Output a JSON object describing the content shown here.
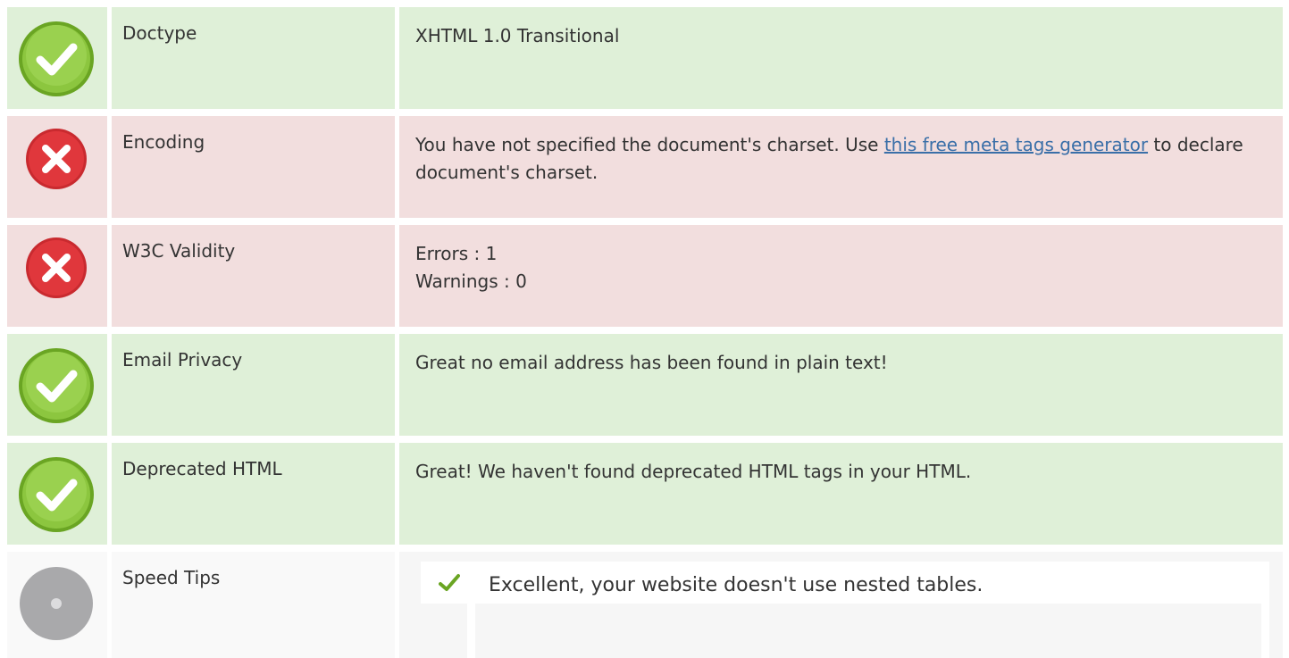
{
  "rows": [
    {
      "status": "good",
      "icon": "check-circle-icon",
      "label": "Doctype",
      "value": "XHTML 1.0 Transitional"
    },
    {
      "status": "bad",
      "icon": "error-circle-icon",
      "label": "Encoding",
      "value_before_link": "You have not specified the document's charset. Use ",
      "link_text": "this free meta tags generator",
      "value_after_link": " to declare document's charset."
    },
    {
      "status": "bad",
      "icon": "error-circle-icon",
      "label": "W3C Validity",
      "errors": "Errors : 1",
      "warnings": "Warnings : 0"
    },
    {
      "status": "good",
      "icon": "check-circle-icon",
      "label": "Email Privacy",
      "value": "Great no email address has been found in plain text!"
    },
    {
      "status": "good",
      "icon": "check-circle-icon",
      "label": "Deprecated HTML",
      "value": "Great! We haven't found deprecated HTML tags in your HTML."
    },
    {
      "status": "neutral",
      "icon": "info-circle-icon",
      "label": "Speed Tips",
      "tips": [
        {
          "icon": "checkmark-icon",
          "text": "Excellent, your website doesn't use nested tables."
        }
      ]
    }
  ],
  "colors": {
    "good_bg": "#dff0d8",
    "bad_bg": "#f2dede",
    "neutral_bg": "#f9f9f9",
    "check_green": "#74b72e",
    "error_red": "#e0373c",
    "neutral_gray": "#a9a9ab",
    "link": "#3a6fa8"
  }
}
